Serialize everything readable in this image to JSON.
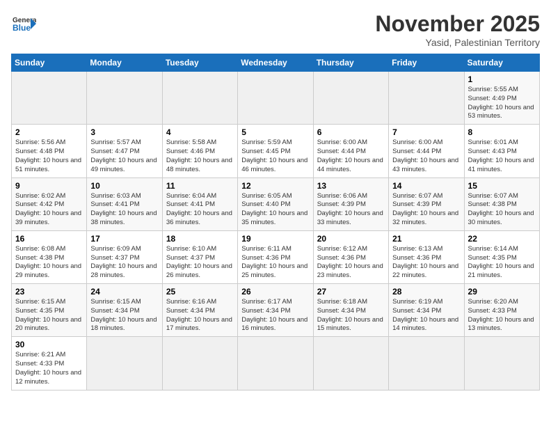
{
  "logo": {
    "general": "General",
    "blue": "Blue"
  },
  "title": "November 2025",
  "location": "Yasid, Palestinian Territory",
  "days_of_week": [
    "Sunday",
    "Monday",
    "Tuesday",
    "Wednesday",
    "Thursday",
    "Friday",
    "Saturday"
  ],
  "weeks": [
    [
      {
        "day": "",
        "info": ""
      },
      {
        "day": "",
        "info": ""
      },
      {
        "day": "",
        "info": ""
      },
      {
        "day": "",
        "info": ""
      },
      {
        "day": "",
        "info": ""
      },
      {
        "day": "",
        "info": ""
      },
      {
        "day": "1",
        "info": "Sunrise: 5:55 AM\nSunset: 4:49 PM\nDaylight: 10 hours and 53 minutes."
      }
    ],
    [
      {
        "day": "2",
        "info": "Sunrise: 5:56 AM\nSunset: 4:48 PM\nDaylight: 10 hours and 51 minutes."
      },
      {
        "day": "3",
        "info": "Sunrise: 5:57 AM\nSunset: 4:47 PM\nDaylight: 10 hours and 49 minutes."
      },
      {
        "day": "4",
        "info": "Sunrise: 5:58 AM\nSunset: 4:46 PM\nDaylight: 10 hours and 48 minutes."
      },
      {
        "day": "5",
        "info": "Sunrise: 5:59 AM\nSunset: 4:45 PM\nDaylight: 10 hours and 46 minutes."
      },
      {
        "day": "6",
        "info": "Sunrise: 6:00 AM\nSunset: 4:44 PM\nDaylight: 10 hours and 44 minutes."
      },
      {
        "day": "7",
        "info": "Sunrise: 6:00 AM\nSunset: 4:44 PM\nDaylight: 10 hours and 43 minutes."
      },
      {
        "day": "8",
        "info": "Sunrise: 6:01 AM\nSunset: 4:43 PM\nDaylight: 10 hours and 41 minutes."
      }
    ],
    [
      {
        "day": "9",
        "info": "Sunrise: 6:02 AM\nSunset: 4:42 PM\nDaylight: 10 hours and 39 minutes."
      },
      {
        "day": "10",
        "info": "Sunrise: 6:03 AM\nSunset: 4:41 PM\nDaylight: 10 hours and 38 minutes."
      },
      {
        "day": "11",
        "info": "Sunrise: 6:04 AM\nSunset: 4:41 PM\nDaylight: 10 hours and 36 minutes."
      },
      {
        "day": "12",
        "info": "Sunrise: 6:05 AM\nSunset: 4:40 PM\nDaylight: 10 hours and 35 minutes."
      },
      {
        "day": "13",
        "info": "Sunrise: 6:06 AM\nSunset: 4:39 PM\nDaylight: 10 hours and 33 minutes."
      },
      {
        "day": "14",
        "info": "Sunrise: 6:07 AM\nSunset: 4:39 PM\nDaylight: 10 hours and 32 minutes."
      },
      {
        "day": "15",
        "info": "Sunrise: 6:07 AM\nSunset: 4:38 PM\nDaylight: 10 hours and 30 minutes."
      }
    ],
    [
      {
        "day": "16",
        "info": "Sunrise: 6:08 AM\nSunset: 4:38 PM\nDaylight: 10 hours and 29 minutes."
      },
      {
        "day": "17",
        "info": "Sunrise: 6:09 AM\nSunset: 4:37 PM\nDaylight: 10 hours and 28 minutes."
      },
      {
        "day": "18",
        "info": "Sunrise: 6:10 AM\nSunset: 4:37 PM\nDaylight: 10 hours and 26 minutes."
      },
      {
        "day": "19",
        "info": "Sunrise: 6:11 AM\nSunset: 4:36 PM\nDaylight: 10 hours and 25 minutes."
      },
      {
        "day": "20",
        "info": "Sunrise: 6:12 AM\nSunset: 4:36 PM\nDaylight: 10 hours and 23 minutes."
      },
      {
        "day": "21",
        "info": "Sunrise: 6:13 AM\nSunset: 4:36 PM\nDaylight: 10 hours and 22 minutes."
      },
      {
        "day": "22",
        "info": "Sunrise: 6:14 AM\nSunset: 4:35 PM\nDaylight: 10 hours and 21 minutes."
      }
    ],
    [
      {
        "day": "23",
        "info": "Sunrise: 6:15 AM\nSunset: 4:35 PM\nDaylight: 10 hours and 20 minutes."
      },
      {
        "day": "24",
        "info": "Sunrise: 6:15 AM\nSunset: 4:34 PM\nDaylight: 10 hours and 18 minutes."
      },
      {
        "day": "25",
        "info": "Sunrise: 6:16 AM\nSunset: 4:34 PM\nDaylight: 10 hours and 17 minutes."
      },
      {
        "day": "26",
        "info": "Sunrise: 6:17 AM\nSunset: 4:34 PM\nDaylight: 10 hours and 16 minutes."
      },
      {
        "day": "27",
        "info": "Sunrise: 6:18 AM\nSunset: 4:34 PM\nDaylight: 10 hours and 15 minutes."
      },
      {
        "day": "28",
        "info": "Sunrise: 6:19 AM\nSunset: 4:34 PM\nDaylight: 10 hours and 14 minutes."
      },
      {
        "day": "29",
        "info": "Sunrise: 6:20 AM\nSunset: 4:33 PM\nDaylight: 10 hours and 13 minutes."
      }
    ],
    [
      {
        "day": "30",
        "info": "Sunrise: 6:21 AM\nSunset: 4:33 PM\nDaylight: 10 hours and 12 minutes."
      },
      {
        "day": "",
        "info": ""
      },
      {
        "day": "",
        "info": ""
      },
      {
        "day": "",
        "info": ""
      },
      {
        "day": "",
        "info": ""
      },
      {
        "day": "",
        "info": ""
      },
      {
        "day": "",
        "info": ""
      }
    ]
  ]
}
